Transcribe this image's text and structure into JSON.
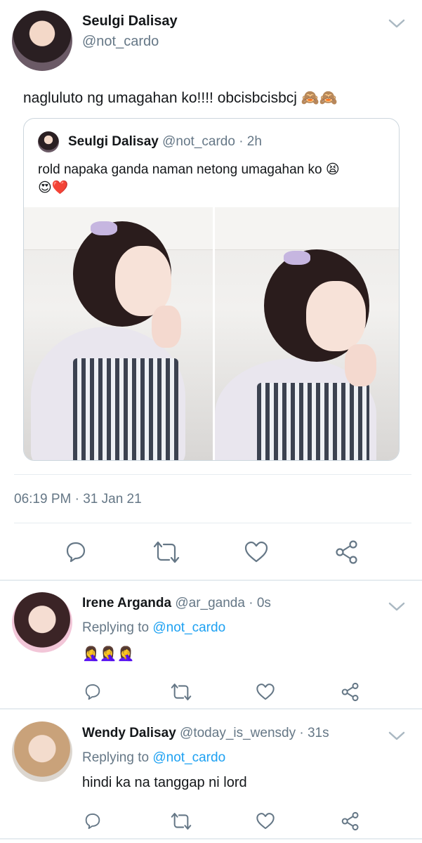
{
  "tweet": {
    "display_name": "Seulgi Dalisay",
    "handle": "@not_cardo",
    "text": "nagluluto ng umagahan ko!!!! obcisbcisbcj 🙈🙈",
    "timestamp": "06:19 PM · 31 Jan 21"
  },
  "quoted": {
    "display_name": "Seulgi Dalisay",
    "handle": "@not_cardo",
    "time": "· 2h",
    "text_line1": "rold napaka ganda naman netong umagahan ko 😫",
    "text_line2": "😍❤️"
  },
  "replies": [
    {
      "display_name": "Irene Arganda",
      "handle": "@ar_ganda",
      "time": "· 0s",
      "replying_prefix": "Replying to",
      "replying_to": "@not_cardo",
      "text": "🤦‍♀️🤦‍♀️🤦‍♀️"
    },
    {
      "display_name": "Wendy Dalisay",
      "handle": "@today_is_wensdy",
      "time": "· 31s",
      "replying_prefix": "Replying to",
      "replying_to": "@not_cardo",
      "text": "hindi ka na tanggap ni lord"
    }
  ],
  "icons": {
    "reply": "reply-icon",
    "retweet": "retweet-icon",
    "like": "heart-icon",
    "share": "share-icon",
    "more": "chevron-down-icon"
  },
  "colors": {
    "text": "#14171a",
    "muted": "#657786",
    "link": "#1da1f2",
    "divider": "#e6ecf0"
  }
}
